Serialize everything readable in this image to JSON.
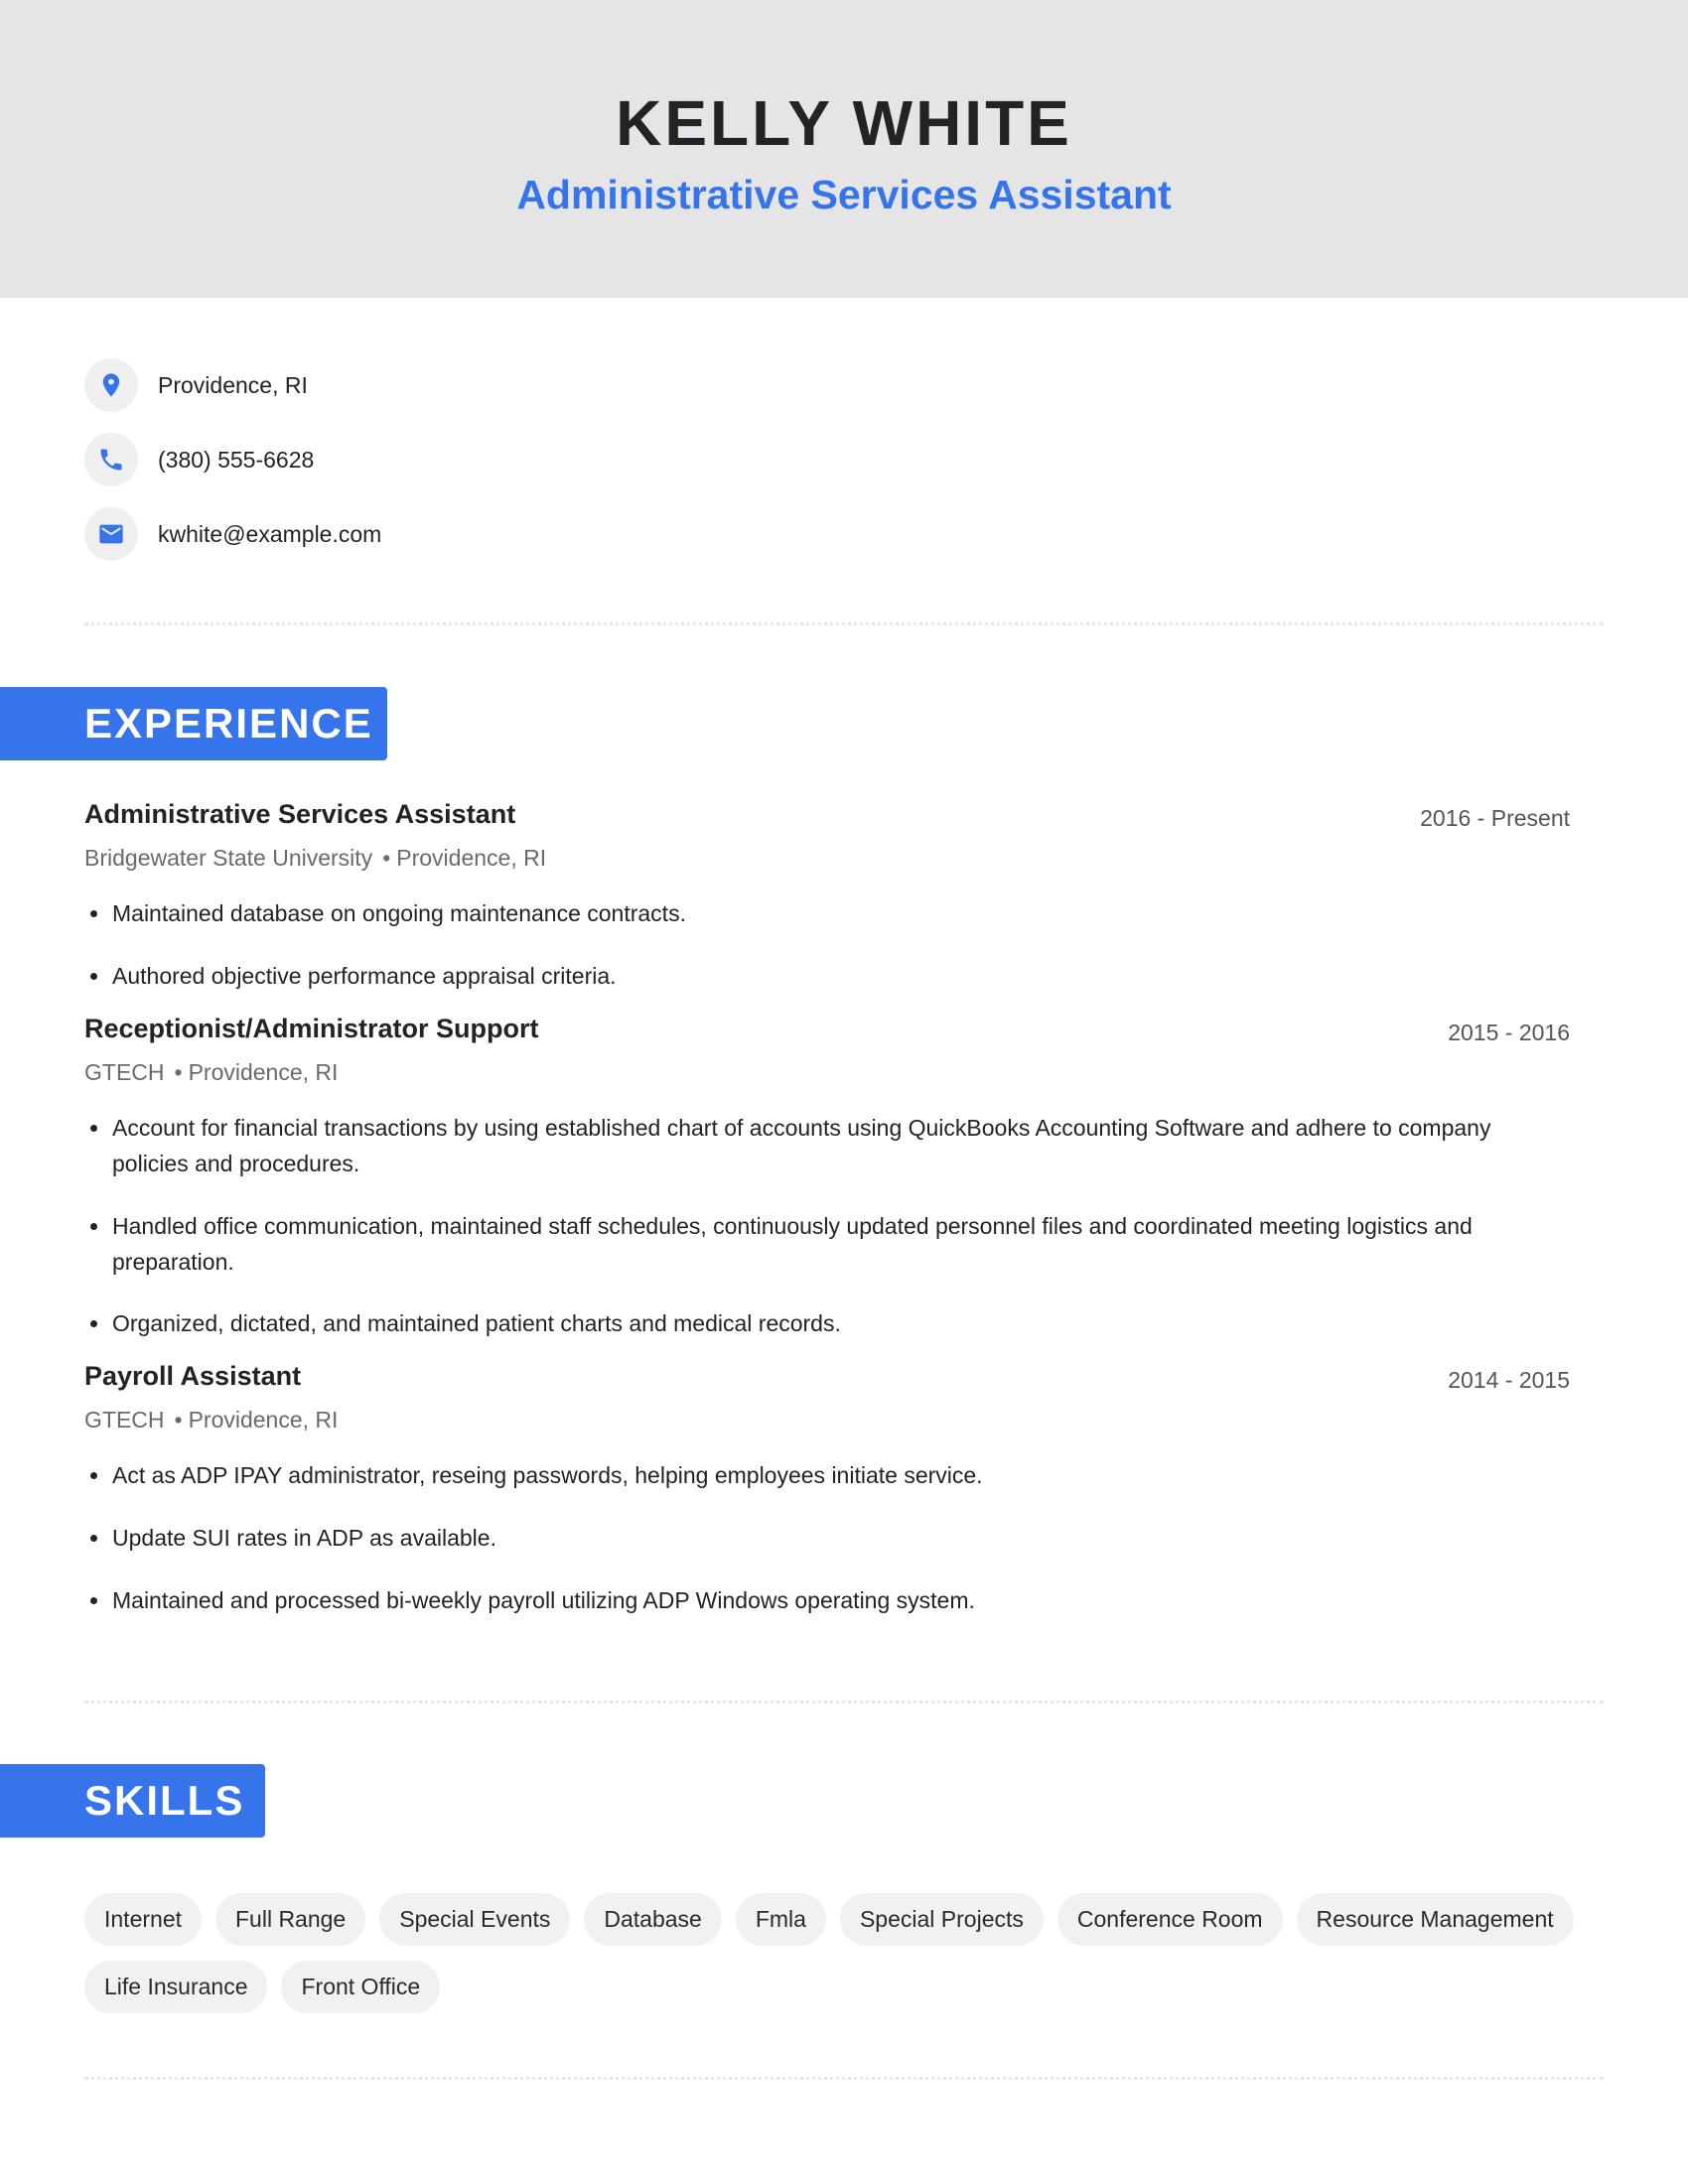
{
  "header": {
    "name": "KELLY WHITE",
    "headline": "Administrative Services Assistant"
  },
  "contact": [
    {
      "icon": "map-pin-icon",
      "text": "Providence, RI"
    },
    {
      "icon": "phone-icon",
      "text": "(380) 555-6628"
    },
    {
      "icon": "mail-icon",
      "text": "kwhite@example.com"
    }
  ],
  "colors": {
    "accent": "#3574ea",
    "header_bg": "#e5e5e5",
    "pill_bg": "#f0f1f2"
  },
  "experience": {
    "title": "EXPERIENCE",
    "jobs": [
      {
        "title": "Administrative Services Assistant",
        "dates": "2016 - Present",
        "company": "Bridgewater State University",
        "separator": "•",
        "location": "Providence, RI",
        "bullets": [
          "Maintained database on ongoing maintenance contracts.",
          "Authored objective performance appraisal criteria."
        ]
      },
      {
        "title": "Receptionist/Administrator Support",
        "dates": "2015 - 2016",
        "company": "GTECH",
        "separator": "•",
        "location": "Providence, RI",
        "bullets": [
          "Account for financial transactions by using established chart of accounts using QuickBooks Accounting Software and adhere to company policies and procedures.",
          "Handled office communication, maintained staff schedules, continuously updated personnel files and coordinated meeting logistics and preparation.",
          "Organized, dictated, and maintained patient charts and medical records."
        ]
      },
      {
        "title": "Payroll Assistant",
        "dates": "2014 - 2015",
        "company": "GTECH",
        "separator": "•",
        "location": "Providence, RI",
        "bullets": [
          "Act as ADP IPAY administrator, reseing passwords, helping employees initiate service.",
          "Update SUI rates in ADP as available.",
          "Maintained and processed bi-weekly payroll utilizing ADP Windows operating system."
        ]
      }
    ]
  },
  "skills": {
    "title": "SKILLS",
    "items": [
      "Internet",
      "Full Range",
      "Special Events",
      "Database",
      "Fmla",
      "Special Projects",
      "Conference Room",
      "Resource Management",
      "Life Insurance",
      "Front Office"
    ]
  }
}
